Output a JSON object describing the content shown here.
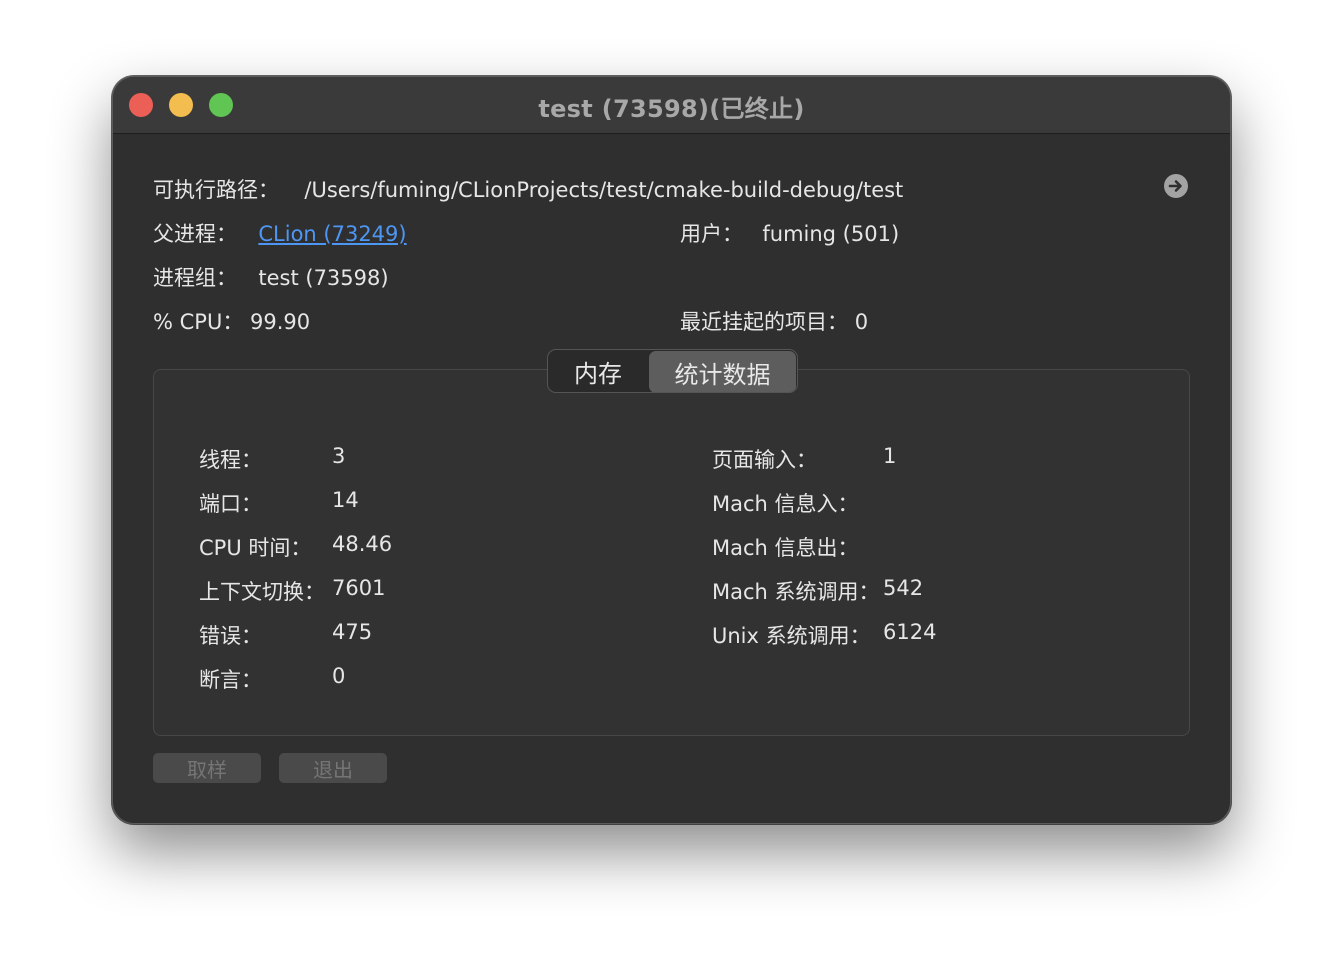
{
  "window": {
    "title": "test (73598)(已终止)"
  },
  "info": {
    "exec_path_label": "可执行路径：",
    "exec_path_value": "/Users/fuming/CLionProjects/test/cmake-build-debug/test",
    "parent_label": "父进程：",
    "parent_value": "CLion (73249)",
    "user_label": "用户：",
    "user_value": "fuming (501)",
    "group_label": "进程组：",
    "group_value": "test (73598)",
    "cpu_label": "% CPU：",
    "cpu_value": "99.90",
    "hangs_label": "最近挂起的项目：",
    "hangs_value": "0"
  },
  "tabs": {
    "memory": "内存",
    "stats": "统计数据",
    "selected": "统计数据"
  },
  "stats_left": [
    {
      "label": "线程：",
      "value": "3"
    },
    {
      "label": "端口：",
      "value": "14"
    },
    {
      "label": "CPU 时间：",
      "value": "48.46"
    },
    {
      "label": "上下文切换：",
      "value": "7601"
    },
    {
      "label": "错误：",
      "value": "475"
    },
    {
      "label": "断言：",
      "value": "0"
    }
  ],
  "stats_right": [
    {
      "label": "页面输入：",
      "value": "1"
    },
    {
      "label": "Mach 信息入：",
      "value": ""
    },
    {
      "label": "Mach 信息出：",
      "value": ""
    },
    {
      "label": "Mach 系统调用：",
      "value": "542"
    },
    {
      "label": "Unix 系统调用：",
      "value": "6124"
    }
  ],
  "buttons": {
    "sample": "取样",
    "quit": "退出"
  },
  "colors": {
    "window_bg": "#2f2f2f",
    "titlebar_bg": "#3a3a3a",
    "link": "#4e96f4",
    "close": "#ec5f57",
    "minimize": "#f4bd4f",
    "maximize": "#61c554"
  }
}
